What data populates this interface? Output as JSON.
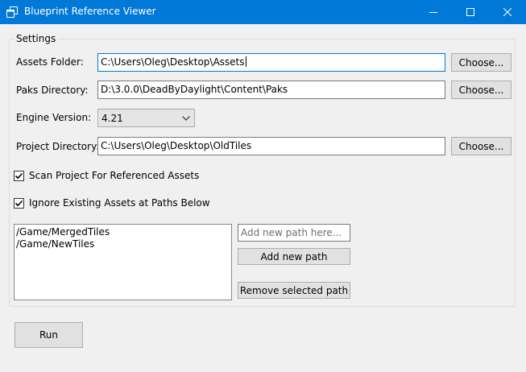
{
  "window": {
    "title": "Blueprint Reference Viewer",
    "icon": "app-window-icon",
    "controls": [
      "minimize-icon",
      "maximize-icon",
      "close-icon"
    ],
    "accent": "#0078d7"
  },
  "settings": {
    "group_label": "Settings",
    "assets_folder": {
      "label": "Assets Folder:",
      "value": "C:\\Users\\Oleg\\Desktop\\Assets",
      "button": "Choose..."
    },
    "paks_directory": {
      "label": "Paks Directory:",
      "value": "D:\\3.0.0\\DeadByDaylight\\Content\\Paks",
      "button": "Choose..."
    },
    "engine_version": {
      "label": "Engine Version:",
      "selected": "4.21"
    },
    "project_directory": {
      "label": "Project Directory:",
      "value": "C:\\Users\\Oleg\\Desktop\\OldTiles",
      "button": "Choose..."
    },
    "scan_project": {
      "label": "Scan Project For Referenced Assets",
      "checked": true
    },
    "ignore_existing": {
      "label": "Ignore Existing Assets at Paths Below",
      "checked": true
    },
    "paths": [
      "/Game/MergedTiles",
      "/Game/NewTiles"
    ],
    "new_path_placeholder": "Add new path here...",
    "add_path_button": "Add new path",
    "remove_path_button": "Remove selected path"
  },
  "run_button": "Run"
}
